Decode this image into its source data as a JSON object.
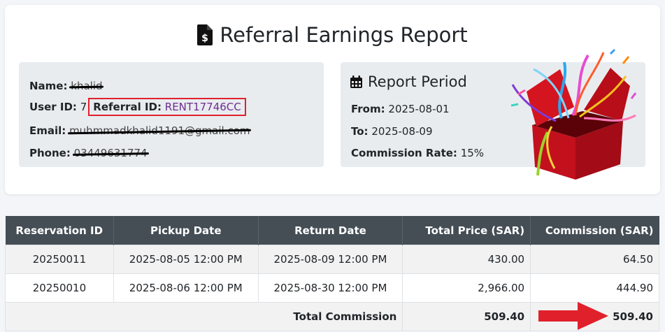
{
  "title": "Referral Earnings Report",
  "user": {
    "name_label": "Name:",
    "name_value": "khalid",
    "userid_label": "User ID:",
    "userid_value": "7",
    "referral_label": "Referral ID:",
    "referral_value": "RENT17746CC",
    "email_label": "Email:",
    "email_value": "muhmmadkhalid1191@gmail.com",
    "phone_label": "Phone:",
    "phone_value": "03449631774"
  },
  "period": {
    "title": "Report Period",
    "from_label": "From:",
    "from_value": "2025-08-01",
    "to_label": "To:",
    "to_value": "2025-08-09",
    "rate_label": "Commission Rate:",
    "rate_value": "15%"
  },
  "table": {
    "headers": [
      "Reservation ID",
      "Pickup Date",
      "Return Date",
      "Total Price (SAR)",
      "Commission (SAR)"
    ],
    "rows": [
      [
        "20250011",
        "2025-08-05 12:00 PM",
        "2025-08-09 12:00 PM",
        "430.00",
        "64.50"
      ],
      [
        "20250010",
        "2025-08-06 12:00 PM",
        "2025-08-30 12:00 PM",
        "2,966.00",
        "444.90"
      ]
    ],
    "total_label": "Total Commission",
    "total_price": "509.40",
    "total_commission": "509.40"
  },
  "colors": {
    "header_bg": "#454d55",
    "highlight_red": "#e0212b",
    "referral_purple": "#6f2c91"
  }
}
